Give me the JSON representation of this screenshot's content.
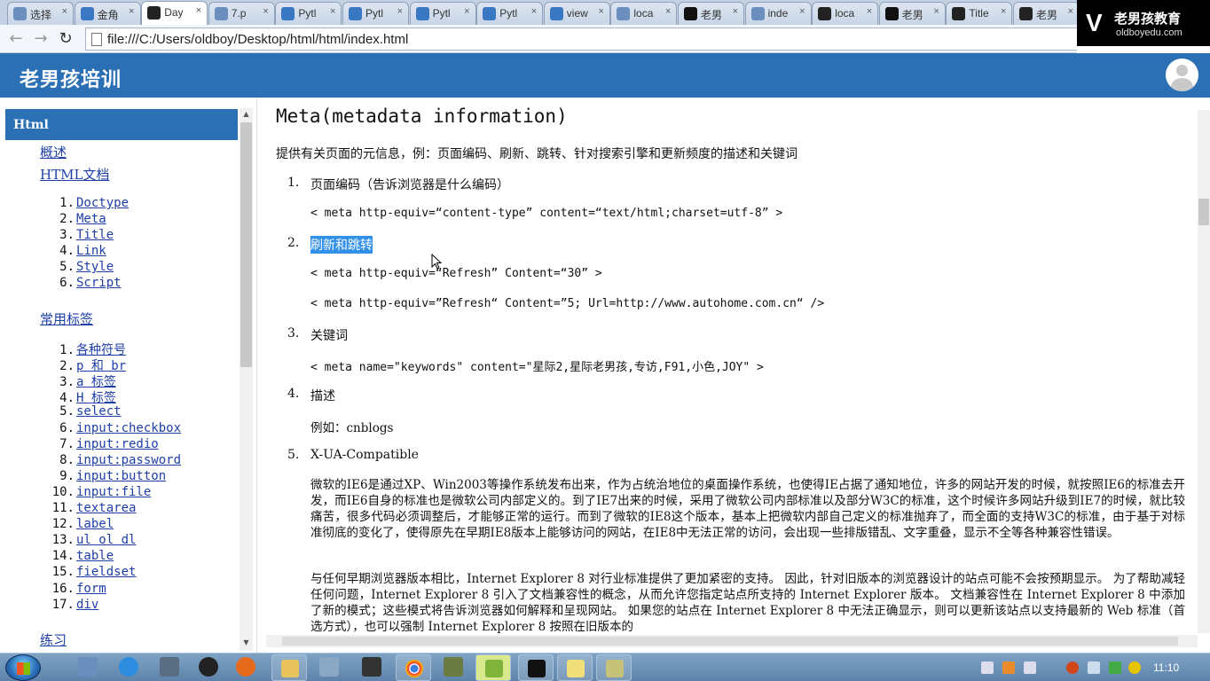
{
  "browser": {
    "tabs": [
      {
        "label": "选择",
        "icon": "page-icon",
        "color": "#6a8fbf"
      },
      {
        "label": "金角",
        "icon": "globe-icon",
        "color": "#3b78c4"
      },
      {
        "label": "Day",
        "icon": "page-icon",
        "color": "#222222",
        "active": true
      },
      {
        "label": "7.p",
        "icon": "page-icon",
        "color": "#6a8fbf"
      },
      {
        "label": "Pytl",
        "icon": "globe-icon",
        "color": "#3b78c4"
      },
      {
        "label": "Pytl",
        "icon": "globe-icon",
        "color": "#3b78c4"
      },
      {
        "label": "Pytl",
        "icon": "globe-icon",
        "color": "#3b78c4"
      },
      {
        "label": "Pytl",
        "icon": "globe-icon",
        "color": "#3b78c4"
      },
      {
        "label": "view",
        "icon": "globe-icon",
        "color": "#3b78c4"
      },
      {
        "label": "loca",
        "icon": "page-icon",
        "color": "#6a8fbf"
      },
      {
        "label": "老男",
        "icon": "oldboy-icon",
        "color": "#111111"
      },
      {
        "label": "inde",
        "icon": "page-icon",
        "color": "#6a8fbf"
      },
      {
        "label": "loca",
        "icon": "pycharm-icon",
        "color": "#222222"
      },
      {
        "label": "老男",
        "icon": "oldboy-icon",
        "color": "#111111"
      },
      {
        "label": "Title",
        "icon": "pycharm-icon",
        "color": "#222222"
      },
      {
        "label": "老男",
        "icon": "pycharm-icon",
        "color": "#222222"
      }
    ],
    "tab_close": "×",
    "back": "←",
    "forward": "→",
    "reload": "↻",
    "url": "file:///C:/Users/oldboy/Desktop/html/html/index.html",
    "watermark": {
      "cn": "老男孩教育",
      "en": "oldboyedu.com"
    }
  },
  "header": {
    "title": "老男孩培训",
    "bg": "#2b70b4"
  },
  "sidebar": {
    "section": "Html",
    "links": {
      "overview": "概述",
      "html_doc": "HTML文档",
      "common_tags": "常用标签",
      "practice": "练习"
    },
    "html_items": [
      {
        "n": "1.",
        "label": "Doctype"
      },
      {
        "n": "2.",
        "label": "Meta"
      },
      {
        "n": "3.",
        "label": "Title"
      },
      {
        "n": "4.",
        "label": "Link"
      },
      {
        "n": "5.",
        "label": "Style"
      },
      {
        "n": "6.",
        "label": "Script"
      }
    ],
    "tag_items": [
      {
        "n": "1.",
        "label": "各种符号"
      },
      {
        "n": "2.",
        "label": "p 和 br"
      },
      {
        "n": "3.",
        "label": "a 标签"
      },
      {
        "n": "4.",
        "label": "H 标签"
      },
      {
        "n": "5.",
        "label": "select"
      },
      {
        "n": "6.",
        "label": "input:checkbox"
      },
      {
        "n": "7.",
        "label": "input:redio"
      },
      {
        "n": "8.",
        "label": "input:password"
      },
      {
        "n": "9.",
        "label": "input:button"
      },
      {
        "n": "10.",
        "label": "input:file"
      },
      {
        "n": "11.",
        "label": "textarea"
      },
      {
        "n": "12.",
        "label": "label"
      },
      {
        "n": "13.",
        "label": "ul ol dl"
      },
      {
        "n": "14.",
        "label": "table"
      },
      {
        "n": "15.",
        "label": "fieldset"
      },
      {
        "n": "16.",
        "label": "form"
      },
      {
        "n": "17.",
        "label": "div"
      }
    ]
  },
  "content": {
    "title": "Meta(metadata information)",
    "intro": "提供有关页面的元信息，例：页面编码、刷新、跳转、针对搜索引擎和更新频度的描述和关键词",
    "items": {
      "i1": {
        "n": "1.",
        "label": "页面编码（告诉浏览器是什么编码）",
        "code": "< meta http-equiv=“content-type” content=“text/html;charset=utf-8” >"
      },
      "i2": {
        "n": "2.",
        "label": "刷新和跳转",
        "code1": "< meta http-equiv=“Refresh” Content=“30” >",
        "code2": "< meta http-equiv=”Refresh“ Content=”5; Url=http://www.autohome.com.cn“ />"
      },
      "i3": {
        "n": "3.",
        "label": "关键词",
        "code": "< meta name=\"keywords\" content=\"星际2,星际老男孩,专访,F91,小色,JOY\" >"
      },
      "i4": {
        "n": "4.",
        "label": "描述",
        "code": "例如：cnblogs"
      },
      "i5": {
        "n": "5.",
        "label": "X-UA-Compatible",
        "p1": "微软的IE6是通过XP、Win2003等操作系统发布出来，作为占统治地位的桌面操作系统，也使得IE占据了通知地位，许多的网站开发的时候，就按照IE6的标准去开发，而IE6自身的标准也是微软公司内部定义的。到了IE7出来的时候，采用了微软公司内部标准以及部分W3C的标准，这个时候许多网站升级到IE7的时候，就比较痛苦，很多代码必须调整后，才能够正常的运行。而到了微软的IE8这个版本，基本上把微软内部自己定义的标准抛弃了，而全面的支持W3C的标准，由于基于对标准彻底的变化了，使得原先在早期IE8版本上能够访问的网站，在IE8中无法正常的访问，会出现一些排版错乱、文字重叠，显示不全等各种兼容性错误。",
        "p2": "与任何早期浏览器版本相比，Internet Explorer 8 对行业标准提供了更加紧密的支持。 因此，针对旧版本的浏览器设计的站点可能不会按预期显示。 为了帮助减轻任何问题，Internet Explorer 8 引入了文档兼容性的概念，从而允许您指定站点所支持的 Internet Explorer 版本。 文档兼容性在 Internet Explorer 8 中添加了新的模式；这些模式将告诉浏览器如何解释和呈现网站。 如果您的站点在 Internet Explorer 8 中无法正确显示，则可以更新该站点以支持最新的 Web 标准（首选方式），也可以强制 Internet Explorer 8 按照在旧版本的"
      }
    }
  },
  "taskbar": {
    "clock": "11:10"
  }
}
